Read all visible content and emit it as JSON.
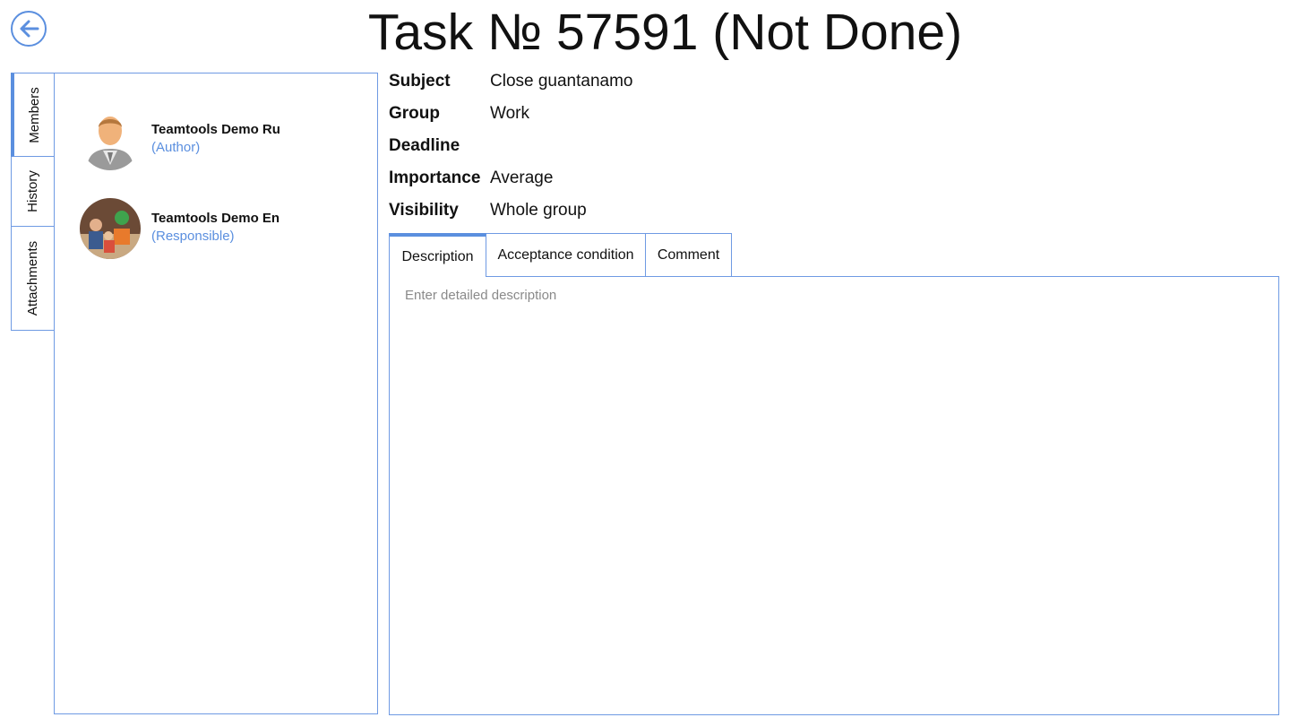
{
  "header": {
    "title": "Task № 57591 (Not Done)",
    "back_icon": "arrow-left-icon"
  },
  "side_tabs": [
    {
      "label": "Members",
      "active": true
    },
    {
      "label": "History",
      "active": false
    },
    {
      "label": "Attachments",
      "active": false
    }
  ],
  "members": [
    {
      "name": "Teamtools Demo Ru",
      "role": "(Author)",
      "avatar": "user-silhouette-avatar"
    },
    {
      "name": "Teamtools Demo En",
      "role": "(Responsible)",
      "avatar": "photo-avatar"
    }
  ],
  "fields": [
    {
      "label": "Subject",
      "value": "Close guantanamo"
    },
    {
      "label": "Group",
      "value": "Work"
    },
    {
      "label": "Deadline",
      "value": ""
    },
    {
      "label": "Importance",
      "value": "Average"
    },
    {
      "label": "Visibility",
      "value": "Whole group"
    }
  ],
  "tabs": [
    {
      "label": "Description",
      "active": true
    },
    {
      "label": "Acceptance condition",
      "active": false
    },
    {
      "label": "Comment",
      "active": false
    }
  ],
  "description": {
    "placeholder": "Enter detailed description",
    "value": ""
  },
  "colors": {
    "accent": "#5b8fdf",
    "border": "#6f9ae3",
    "link": "#5b8fdf"
  }
}
